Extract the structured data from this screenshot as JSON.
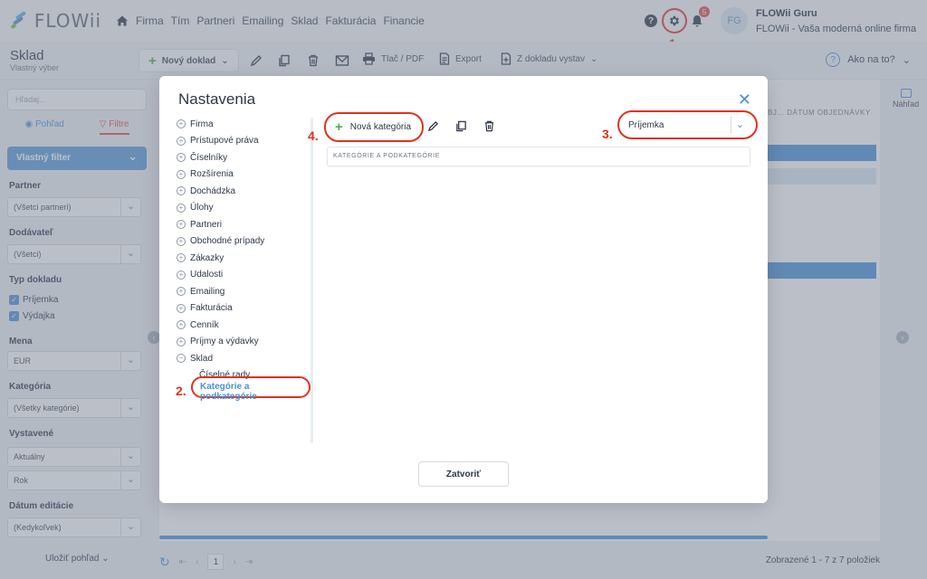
{
  "app": {
    "logo": "FLOWii"
  },
  "nav": [
    "Firma",
    "Tím",
    "Partneri",
    "Emailing",
    "Sklad",
    "Fakturácia",
    "Financie"
  ],
  "user": {
    "initials": "FG",
    "name": "FLOWii Guru",
    "subtitle": "FLOWii - Vaša moderná online firma",
    "notifications": "5"
  },
  "steps": {
    "s1": "1.",
    "s2": "2.",
    "s3": "3.",
    "s4": "4."
  },
  "toolbar": {
    "title": "Sklad",
    "subtitle": "Vlastný výber",
    "new_doc": "Nový doklad",
    "print": "Tlač / PDF",
    "export": "Export",
    "from_doc": "Z dokladu vystav",
    "help": "Ako na to?"
  },
  "sidebar": {
    "search_placeholder": "Hľadaj...",
    "tab_view": "Pohľad",
    "tab_filter": "Filtre",
    "custom_filter": "Vlastný filter",
    "partner_label": "Partner",
    "partner_value": "(Všetci partneri)",
    "supplier_label": "Dodávateľ",
    "supplier_value": "(Všetci)",
    "doc_type_label": "Typ dokladu",
    "doc_type_1": "Príjemka",
    "doc_type_2": "Výdajka",
    "currency_label": "Mena",
    "currency_value": "EUR",
    "category_label": "Kategória",
    "category_value": "(Všetky kategórie)",
    "issued_label": "Vystavené",
    "issued_value_1": "Aktuálny",
    "issued_value_2": "Rok",
    "edit_date_label": "Dátum editácie",
    "edit_date_value": "(Kedykoľvek)",
    "save_view": "Uložiť pohľad"
  },
  "main": {
    "col_header": "BJ...  DÁTUM OBJEDNÁVKY",
    "preview": "Náhľad",
    "page": "1",
    "shown": "Zobrazené 1 - 7 z 7 položiek"
  },
  "modal": {
    "title": "Nastavenia",
    "tree": [
      "Firma",
      "Prístupové práva",
      "Číselníky",
      "Rozšírenia",
      "Dochádzka",
      "Úlohy",
      "Partneri",
      "Obchodné prípady",
      "Zákazky",
      "Udalosti",
      "Emailing",
      "Fakturácia",
      "Cenník",
      "Príjmy a výdavky",
      "Sklad"
    ],
    "sub_1": "Číselné rady",
    "sub_active": "Kategórie a podkategórie",
    "new_category": "Nová kategória",
    "type_value": "Príjemka",
    "table_header": "KATEGÓRIE A PODKATEGÓRIE",
    "close": "Zatvoriť"
  },
  "colors": {
    "accent": "#4a90d9",
    "highlight": "#e0321e",
    "green": "#4caf50"
  }
}
